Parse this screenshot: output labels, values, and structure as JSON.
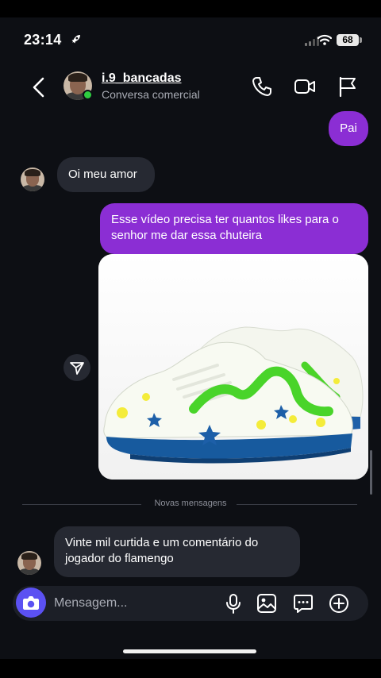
{
  "status_bar": {
    "time": "23:14",
    "battery": "68"
  },
  "header": {
    "username": "i.9_bancadas",
    "subtitle": "Conversa comercial",
    "icons": [
      "back-arrow-icon",
      "phone-icon",
      "video-camera-icon",
      "flag-icon"
    ]
  },
  "messages": [
    {
      "direction": "sent",
      "text": "Pai"
    },
    {
      "direction": "received",
      "text": "Oi meu amor"
    },
    {
      "direction": "sent",
      "text": "Esse vídeo precisa ter quantos likes para o senhor me dar essa chuteira"
    },
    {
      "direction": "sent",
      "type": "image",
      "subject": "futsal-shoe"
    },
    {
      "direction": "received",
      "text": "Vinte mil curtida e um comentário do jogador do flamengo"
    }
  ],
  "divider_label": "Novas mensagens",
  "composer": {
    "placeholder": "Mensagem...",
    "icons": [
      "camera-icon",
      "microphone-icon",
      "gallery-icon",
      "sticker-icon",
      "plus-icon"
    ]
  },
  "colors": {
    "sent_bubble": "#8b2ed4",
    "received_bubble": "#262932",
    "background": "#0d0f14",
    "camera_button": "#5b51f2",
    "online": "#2ecc40"
  }
}
